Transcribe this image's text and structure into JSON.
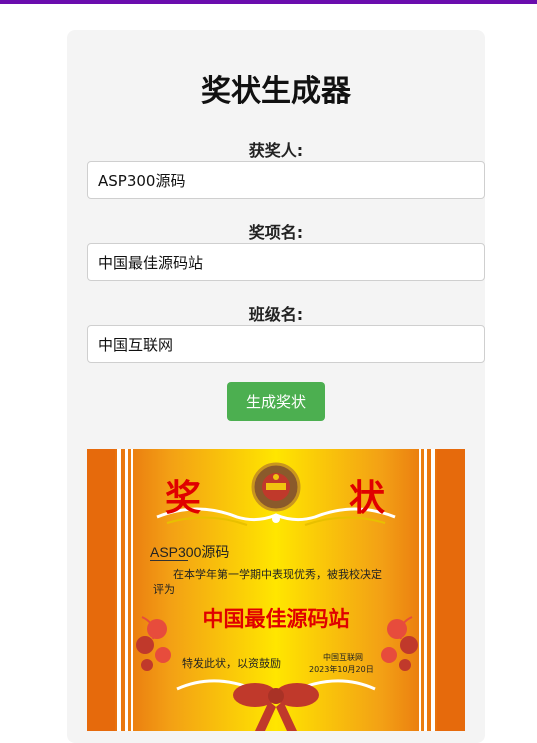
{
  "page": {
    "title": "奖状生成器",
    "accent": "#6a0dad"
  },
  "form": {
    "recipient_label": "获奖人:",
    "recipient_value": "ASP300源码",
    "award_label": "奖项名:",
    "award_value": "中国最佳源码站",
    "class_label": "班级名:",
    "class_value": "中国互联网",
    "submit_label": "生成奖状",
    "submit_color": "#4caf50"
  },
  "certificate": {
    "heading_left": "奖",
    "heading_right": "状",
    "recipient": "ASP300源码",
    "description": "在本学年第一学期中表现优秀，被我校决定",
    "evaluated_as": "评为",
    "award": "中国最佳源码站",
    "incentive": "特发此状，以资鼓励",
    "issuer": "中国互联网",
    "date": "2023年10月20日"
  }
}
